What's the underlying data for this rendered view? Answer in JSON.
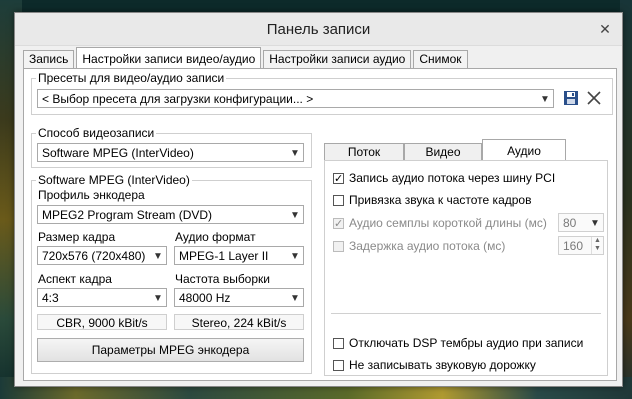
{
  "window": {
    "title": "Панель записи"
  },
  "tabs": [
    "Запись",
    "Настройки записи видео/аудио",
    "Настройки записи аудио",
    "Снимок"
  ],
  "presets": {
    "title": "Пресеты для видео/аудио записи",
    "select_value": "< Выбор пресета для загрузки конфигурации... >",
    "save_icon": "save-icon",
    "clear_icon": "close-icon"
  },
  "capture_method": {
    "title": "Способ видеозаписи",
    "value": "Software MPEG (InterVideo)"
  },
  "software_mpeg": {
    "title": "Software MPEG (InterVideo)",
    "profile_label": "Профиль энкодера",
    "profile_value": "MPEG2 Program Stream (DVD)",
    "frame_size_label": "Размер кадра",
    "frame_size_value": "720x576 (720x480)",
    "audio_format_label": "Аудио формат",
    "audio_format_value": "MPEG-1 Layer II",
    "aspect_label": "Аспект кадра",
    "aspect_value": "4:3",
    "sample_rate_label": "Частота выборки",
    "sample_rate_value": "48000 Hz",
    "video_info": "CBR, 9000 kBit/s",
    "audio_info": "Stereo, 224 kBit/s",
    "mpeg_params_button": "Параметры MPEG энкодера"
  },
  "subtabs": [
    "Поток",
    "Видео",
    "Аудио"
  ],
  "audio": {
    "pci_bus": {
      "label": "Запись аудио потока через шину PCI",
      "checked": true
    },
    "bind_framerate": {
      "label": "Привязка звука к частоте кадров",
      "checked": false
    },
    "short_samples": {
      "label": "Аудио семплы короткой длины (мс)",
      "checked": true,
      "value": "80"
    },
    "stream_delay": {
      "label": "Задержка аудио потока (мс)",
      "checked": false,
      "value": "160"
    },
    "disable_dsp": {
      "label": "Отключать DSP тембры аудио при записи",
      "checked": false
    },
    "no_audio_track": {
      "label": "Не записывать звуковую дорожку",
      "checked": false
    }
  }
}
